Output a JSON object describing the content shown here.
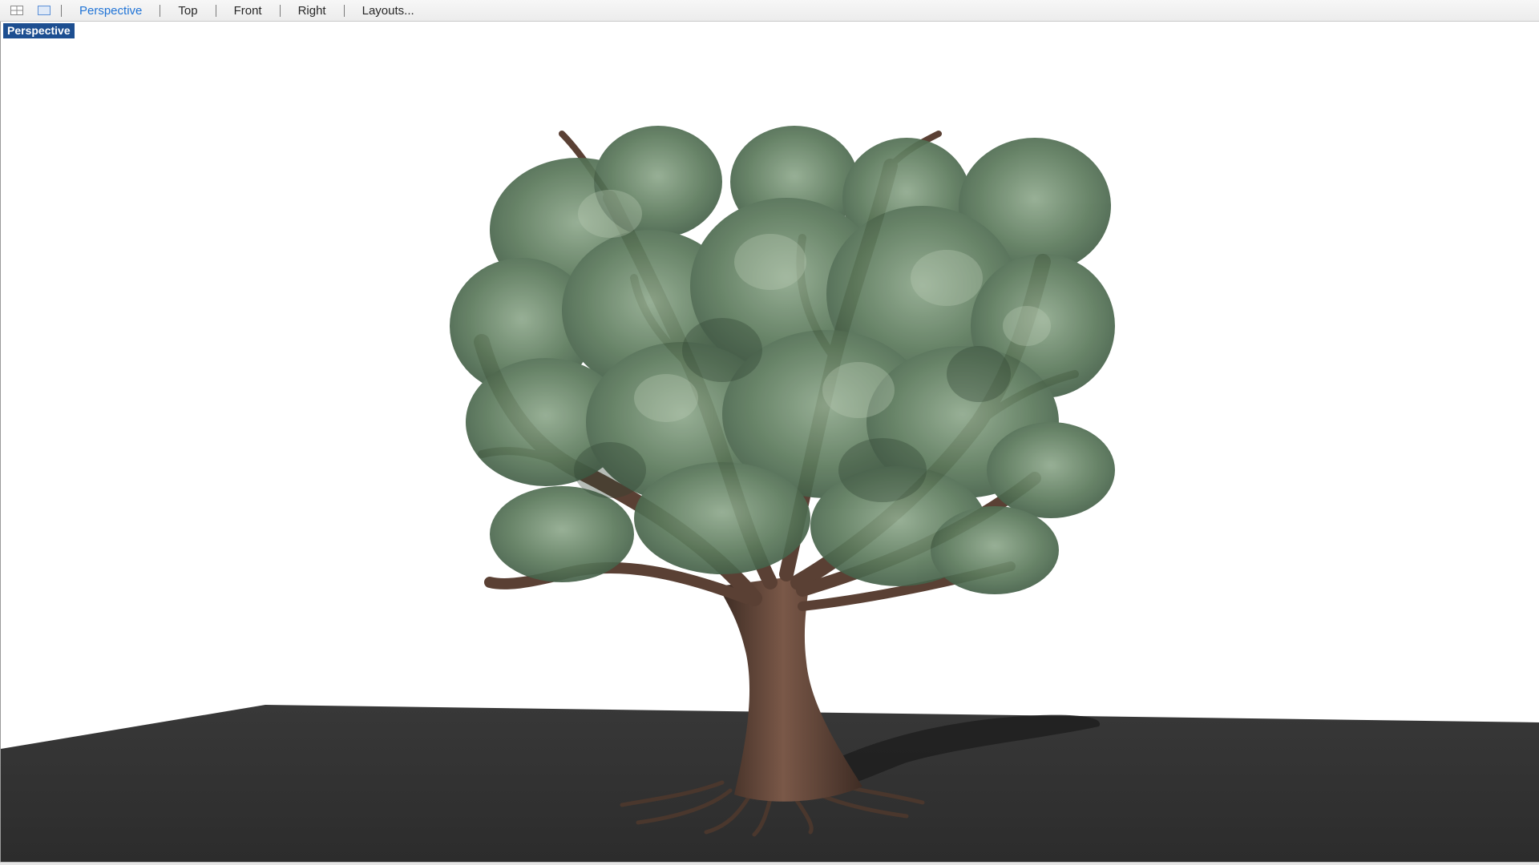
{
  "toolbar": {
    "icons": [
      "grid-layout-icon",
      "single-viewport-icon"
    ],
    "tabs": [
      {
        "label": "Perspective",
        "active": true
      },
      {
        "label": "Top",
        "active": false
      },
      {
        "label": "Front",
        "active": false
      },
      {
        "label": "Right",
        "active": false
      },
      {
        "label": "Layouts...",
        "active": false
      }
    ]
  },
  "viewport": {
    "label": "Perspective",
    "object": "tree-model",
    "ground_color": "#2f2f2f",
    "background_color": "#ffffff"
  },
  "colors": {
    "accent": "#1f73d6",
    "viewport_label_bg": "#1d4f91",
    "foliage": "#5e7d5e",
    "bark": "#6b4a3a"
  }
}
